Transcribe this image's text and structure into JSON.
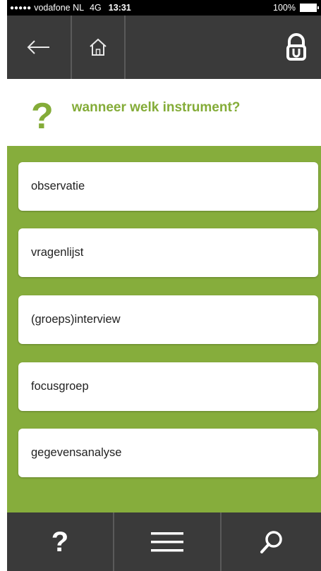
{
  "status_bar": {
    "signal": "●●●●●",
    "carrier": "vodafone NL",
    "network": "4G",
    "time": "13:31",
    "battery": "100%"
  },
  "nav": {
    "back_icon": "arrow-left-icon",
    "home_icon": "home-icon",
    "logo_icon": "lock-logo-icon"
  },
  "heading": {
    "mark": "?",
    "title": "wanneer welk instrument?"
  },
  "items": [
    {
      "label": "observatie"
    },
    {
      "label": "vragenlijst"
    },
    {
      "label": "(groeps)interview"
    },
    {
      "label": "focusgroep"
    },
    {
      "label": "gegevensanalyse"
    }
  ],
  "bottom_bar": {
    "help_label": "?",
    "menu_icon": "hamburger-menu-icon",
    "search_icon": "search-icon"
  },
  "colors": {
    "accent": "#86ad3c",
    "bar": "#3a3a3a"
  }
}
